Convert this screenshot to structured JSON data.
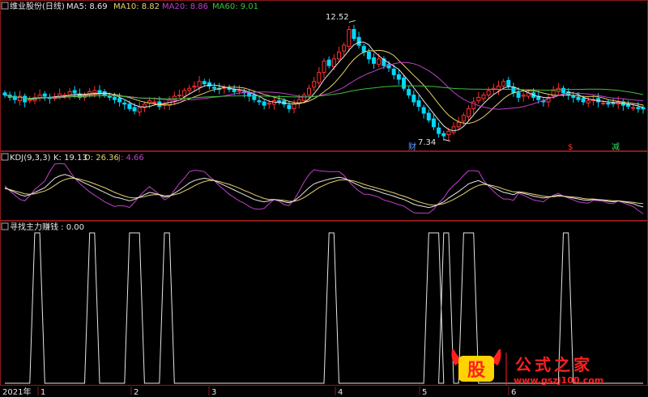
{
  "main_panel": {
    "title": "维业股份(日线)",
    "ma": [
      {
        "label": "MA5: 8.69",
        "color": "#e6e6e6"
      },
      {
        "label": "MA10: 8.82",
        "color": "#e8d36a"
      },
      {
        "label": "MA20: 8.86",
        "color": "#c040c8"
      },
      {
        "label": "MA60: 9.01",
        "color": "#3fbf3f"
      }
    ],
    "high_label": "12.52",
    "low_label": "7.34",
    "markers": [
      {
        "text": "财",
        "color": "#5aa0ff"
      },
      {
        "text": "$",
        "color": "#ff3030"
      },
      {
        "text": "减",
        "color": "#30e060"
      }
    ]
  },
  "kdj_panel": {
    "title": "KDJ(9,3,3)",
    "k_label": "K: 19.13",
    "d_label": "D: 26.36",
    "j_label": "J: 4.66",
    "k_color": "#e6e6e6",
    "d_color": "#e8d36a",
    "j_color": "#c040c8"
  },
  "signal_panel": {
    "title": "寻找主力赚钱 : 0.00",
    "color": "#e6e6e6"
  },
  "x_axis": {
    "labels": [
      "2021年",
      "1",
      "2",
      "3",
      "4",
      "5",
      "6"
    ]
  },
  "watermark": {
    "logo_char": "股",
    "site_name": "公式之家",
    "url": "www.gszj100.com"
  },
  "colors": {
    "up": "#ff3030",
    "down": "#00d8ff",
    "border": "#8b1a1a",
    "background": "#000000"
  },
  "chart_data": {
    "type": "candlestick",
    "price_axis": {
      "high_marker": 12.52,
      "low_marker": 7.34,
      "ylim": [
        7.0,
        13.0
      ]
    },
    "ma_latest": {
      "MA5": 8.69,
      "MA10": 8.82,
      "MA20": 8.86,
      "MA60": 9.01
    },
    "kdj_latest": {
      "K": 19.13,
      "D": 26.36,
      "J": 4.66
    },
    "close": [
      9.3,
      9.2,
      9.1,
      9.25,
      9.0,
      9.1,
      9.2,
      9.3,
      9.25,
      9.15,
      9.2,
      9.35,
      9.3,
      9.45,
      9.4,
      9.2,
      9.3,
      9.45,
      9.5,
      9.4,
      9.3,
      9.2,
      9.1,
      9.0,
      8.9,
      8.7,
      8.6,
      8.75,
      8.9,
      9.05,
      9.0,
      8.8,
      8.9,
      9.1,
      9.25,
      9.3,
      9.5,
      9.6,
      9.7,
      9.9,
      9.8,
      9.7,
      9.6,
      9.55,
      9.65,
      9.55,
      9.45,
      9.5,
      9.4,
      9.25,
      9.1,
      9.0,
      8.85,
      8.95,
      9.05,
      9.0,
      8.9,
      8.7,
      8.9,
      9.1,
      9.3,
      9.6,
      9.9,
      10.3,
      10.8,
      10.6,
      10.9,
      11.2,
      11.5,
      12.2,
      11.8,
      11.5,
      11.2,
      10.9,
      10.7,
      10.9,
      10.6,
      10.5,
      10.2,
      10.0,
      9.6,
      9.3,
      9.0,
      8.8,
      8.5,
      8.2,
      7.9,
      7.6,
      7.5,
      7.7,
      7.9,
      8.1,
      8.4,
      8.7,
      9.0,
      9.2,
      9.3,
      9.5,
      9.6,
      9.7,
      9.9,
      9.7,
      9.4,
      9.2,
      9.3,
      9.4,
      9.2,
      9.1,
      9.0,
      9.2,
      9.5,
      9.6,
      9.4,
      9.3,
      9.2,
      9.1,
      9.0,
      9.05,
      9.1,
      9.0,
      8.95,
      8.9,
      8.95,
      9.0,
      8.85,
      8.8,
      8.75,
      8.7,
      8.69
    ],
    "kdj_k": [
      60,
      55,
      50,
      45,
      42,
      45,
      50,
      55,
      60,
      70,
      80,
      85,
      88,
      85,
      80,
      75,
      70,
      65,
      60,
      55,
      50,
      45,
      40,
      38,
      35,
      32,
      35,
      40,
      45,
      50,
      48,
      45,
      40,
      42,
      48,
      55,
      62,
      70,
      75,
      78,
      80,
      78,
      75,
      70,
      65,
      60,
      55,
      50,
      45,
      40,
      35,
      32,
      30,
      32,
      35,
      33,
      30,
      28,
      32,
      40,
      50,
      60,
      68,
      72,
      75,
      78,
      80,
      82,
      80,
      75,
      70,
      65,
      60,
      58,
      55,
      52,
      48,
      45,
      42,
      38,
      35,
      30,
      25,
      22,
      20,
      18,
      20,
      25,
      30,
      38,
      45,
      52,
      60,
      68,
      72,
      75,
      70,
      65,
      60,
      55,
      50,
      48,
      45,
      50,
      48,
      45,
      42,
      40,
      38,
      40,
      42,
      44,
      42,
      40,
      38,
      36,
      34,
      33,
      35,
      34,
      33,
      31,
      30,
      32,
      30,
      28,
      26,
      22,
      19
    ],
    "kdj_d": [
      58,
      56,
      53,
      50,
      47,
      46,
      47,
      50,
      53,
      58,
      65,
      72,
      77,
      80,
      80,
      78,
      75,
      72,
      68,
      64,
      60,
      55,
      50,
      46,
      42,
      39,
      38,
      39,
      41,
      44,
      45,
      45,
      43,
      43,
      45,
      48,
      53,
      58,
      64,
      69,
      73,
      75,
      75,
      73,
      70,
      67,
      63,
      59,
      54,
      50,
      45,
      41,
      37,
      35,
      35,
      34,
      33,
      31,
      31,
      34,
      39,
      46,
      53,
      60,
      65,
      70,
      73,
      76,
      77,
      76,
      74,
      71,
      67,
      64,
      61,
      58,
      55,
      52,
      49,
      45,
      42,
      38,
      34,
      30,
      27,
      24,
      23,
      24,
      26,
      30,
      35,
      41,
      47,
      54,
      60,
      65,
      67,
      66,
      64,
      61,
      57,
      54,
      51,
      51,
      50,
      48,
      46,
      44,
      42,
      41,
      41,
      42,
      42,
      41,
      40,
      39,
      37,
      36,
      36,
      35,
      34,
      33,
      32,
      32,
      31,
      30,
      29,
      27,
      26.36
    ],
    "kdj_j": [
      64,
      53,
      44,
      35,
      32,
      43,
      56,
      65,
      74,
      94,
      110,
      111,
      110,
      95,
      80,
      69,
      60,
      51,
      44,
      37,
      30,
      25,
      20,
      22,
      21,
      18,
      29,
      42,
      53,
      62,
      54,
      45,
      34,
      40,
      54,
      69,
      80,
      94,
      97,
      96,
      94,
      84,
      75,
      64,
      55,
      46,
      39,
      32,
      27,
      20,
      15,
      14,
      16,
      26,
      35,
      31,
      24,
      22,
      34,
      52,
      72,
      88,
      98,
      96,
      95,
      94,
      94,
      94,
      86,
      73,
      62,
      53,
      46,
      46,
      43,
      40,
      34,
      31,
      28,
      24,
      21,
      14,
      7,
      6,
      6,
      6,
      14,
      27,
      38,
      54,
      65,
      74,
      86,
      96,
      96,
      95,
      76,
      63,
      52,
      43,
      36,
      36,
      33,
      48,
      44,
      39,
      34,
      32,
      30,
      38,
      44,
      48,
      42,
      38,
      34,
      30,
      28,
      27,
      33,
      32,
      31,
      27,
      26,
      32,
      28,
      24,
      20,
      12,
      4.66
    ],
    "signal_peaks": [
      {
        "start": 6,
        "end": 7,
        "top": 1
      },
      {
        "start": 17,
        "end": 18,
        "top": 1
      },
      {
        "start": 25,
        "end": 27,
        "top": 1
      },
      {
        "start": 32,
        "end": 33,
        "top": 1
      },
      {
        "start": 65,
        "end": 66,
        "top": 1
      },
      {
        "start": 85,
        "end": 87,
        "top": 1
      },
      {
        "start": 88,
        "end": 89,
        "top": 1
      },
      {
        "start": 92,
        "end": 94,
        "top": 1
      },
      {
        "start": 112,
        "end": 113,
        "top": 1
      }
    ],
    "signal_latest": 0.0
  }
}
